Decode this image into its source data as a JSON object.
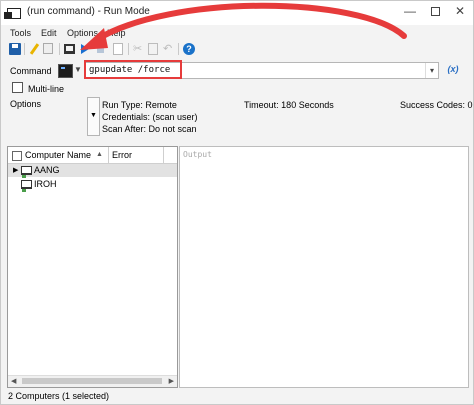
{
  "window": {
    "title": "(run command) - Run Mode",
    "min_glyph": "—",
    "close_glyph": "✕"
  },
  "menu": {
    "items": [
      "Tools",
      "Edit",
      "Options",
      "Help"
    ]
  },
  "toolbar": {
    "icons": [
      "save-icon",
      "edit-icon",
      "copy-icon",
      "computer-icon",
      "run-icon",
      "stop-icon",
      "new-document-icon",
      "cut-icon",
      "paste-icon",
      "undo-icon",
      "help-icon"
    ],
    "help_glyph": "?"
  },
  "command": {
    "label": "Command",
    "value": "gpupdate /force",
    "variables_button": "(x)",
    "highlight_color": "#e63b3b"
  },
  "multiline": {
    "label": "Multi-line",
    "checked": false
  },
  "options": {
    "label": "Options",
    "run_type": "Run Type: Remote",
    "credentials": "Credentials: (scan user)",
    "scan_after": "Scan After: Do not scan",
    "timeout": "Timeout: 180 Seconds",
    "success_codes": "Success Codes: 0"
  },
  "computer_grid": {
    "columns": [
      "Computer Name",
      "Error"
    ],
    "rows": [
      {
        "name": "AANG",
        "selected": true
      },
      {
        "name": "IROH",
        "selected": false
      }
    ]
  },
  "output": {
    "placeholder": "Output"
  },
  "status": {
    "text": "2 Computers (1 selected)"
  },
  "colors": {
    "accent": "#1a6fd0",
    "annotation": "#e63b3b"
  }
}
